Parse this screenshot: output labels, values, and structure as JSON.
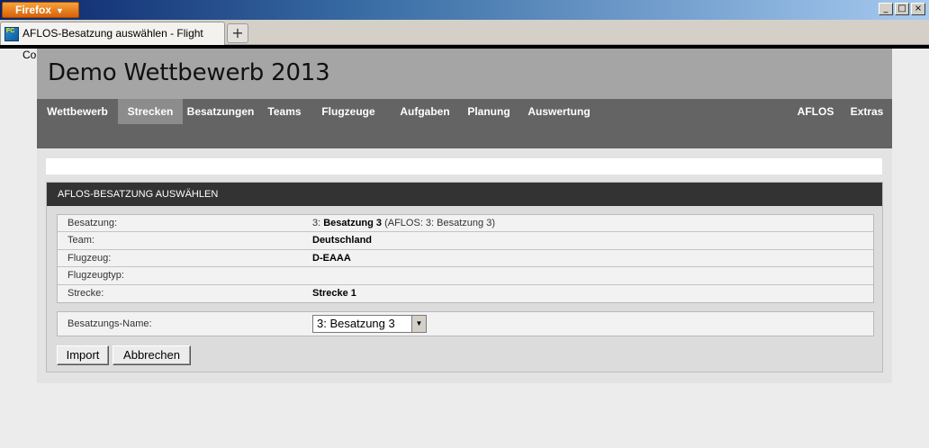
{
  "browser": {
    "menu_button": "Firefox",
    "tab_title": "AFLOS-Besatzung auswählen - Flight Contest",
    "favicon_text": "FC",
    "new_tab_symbol": "+",
    "window_controls": [
      "_",
      "□",
      "×"
    ]
  },
  "site": {
    "title": "Demo Wettbewerb 2013"
  },
  "nav": {
    "items": [
      {
        "label": "Wettbewerb",
        "active": false
      },
      {
        "label": "Strecken",
        "active": true
      },
      {
        "label": "Besatzungen",
        "active": false
      },
      {
        "label": "Teams",
        "active": false
      },
      {
        "label": "Flugzeuge",
        "active": false
      },
      {
        "label": "Aufgaben",
        "active": false
      },
      {
        "label": "Planung",
        "active": false
      },
      {
        "label": "Auswertung",
        "active": false
      }
    ],
    "right_items": [
      {
        "label": "AFLOS"
      },
      {
        "label": "Extras"
      }
    ]
  },
  "panel": {
    "heading": "AFLOS-BESATZUNG AUSWÄHLEN",
    "rows": [
      {
        "label": "Besatzung:",
        "prefix": "3: ",
        "value": "Besatzung 3",
        "suffix": " (AFLOS: 3: Besatzung 3)"
      },
      {
        "label": "Team:",
        "prefix": "",
        "value": "Deutschland",
        "suffix": ""
      },
      {
        "label": "Flugzeug:",
        "prefix": "",
        "value": "D-EAAA",
        "suffix": ""
      },
      {
        "label": "Flugzeugtyp:",
        "prefix": "",
        "value": "",
        "suffix": ""
      },
      {
        "label": "Strecke:",
        "prefix": "",
        "value": "Strecke 1",
        "suffix": ""
      }
    ],
    "select": {
      "label": "Besatzungs-Name:",
      "selected": "3: Besatzung 3"
    },
    "buttons": {
      "import": "Import",
      "cancel": "Abbrechen"
    }
  },
  "colors": {
    "header_bg": "#a5a5a5",
    "nav_bg": "#646464",
    "nav_active_bg": "#8c8c8c",
    "panel_head_bg": "#333333",
    "firefox_orange": "#e0741a"
  }
}
